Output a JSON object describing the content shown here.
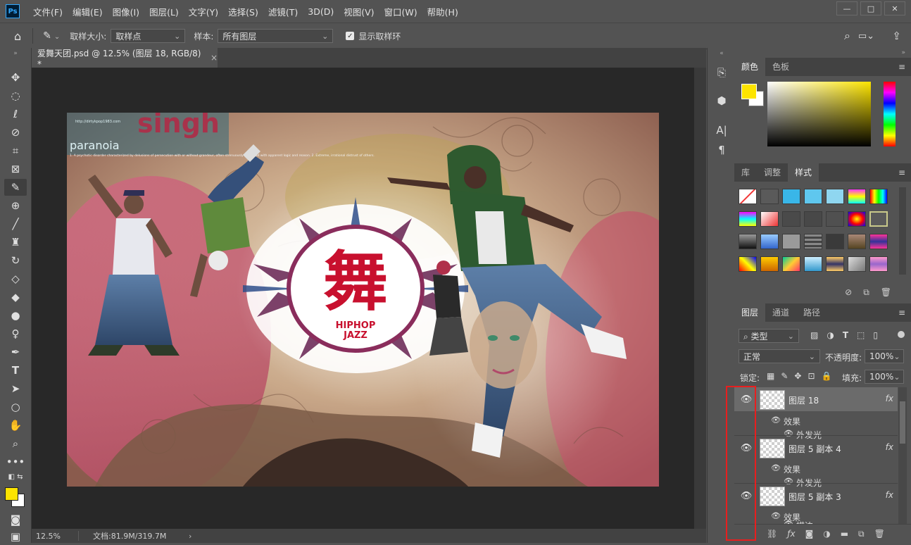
{
  "app": {
    "logo": "Ps"
  },
  "menu": [
    "文件(F)",
    "编辑(E)",
    "图像(I)",
    "图层(L)",
    "文字(Y)",
    "选择(S)",
    "滤镜(T)",
    "3D(D)",
    "视图(V)",
    "窗口(W)",
    "帮助(H)"
  ],
  "window_controls": {
    "minimize": "—",
    "restore": "□",
    "close": "✕"
  },
  "options": {
    "sample_size_label": "取样大小:",
    "sample_size_value": "取样点",
    "sample_label": "样本:",
    "sample_value": "所有图层",
    "show_ring_label": "显示取样环"
  },
  "document": {
    "tab_title": "爱舞天团.psd @ 12.5% (图层 18, RGB/8) *",
    "zoom": "12.5%",
    "doc_info": "文档:81.9M/319.7M"
  },
  "artwork": {
    "headline": "singh",
    "subhead": "paranoia",
    "logo_char": "舞",
    "logo_line1": "HIPHOP",
    "logo_line2": "JAZZ",
    "fine_print": "1. A psychotic disorder characterized by delusions of persecution with or without grandeur, often strenuously defended with apparent logic and reason. 2. Extreme, irrational distrust of others.",
    "url": "http://dirtykpop1983.com"
  },
  "color_panel": {
    "tabs": [
      "颜色",
      "色板"
    ],
    "foreground": "#fde400",
    "background": "#ffffff"
  },
  "styles_panel": {
    "tabs": [
      "库",
      "调整",
      "样式"
    ]
  },
  "layers_panel": {
    "tabs": [
      "图层",
      "通道",
      "路径"
    ],
    "filter_label": "类型",
    "blend_mode": "正常",
    "opacity_label": "不透明度:",
    "opacity_value": "100%",
    "lock_label": "锁定:",
    "fill_label": "填充:",
    "fill_value": "100%",
    "layers": [
      {
        "name": "图层 18",
        "effects_label": "效果",
        "effect": "外发光",
        "fx": "fx"
      },
      {
        "name": "图层 5 副本 4",
        "effects_label": "效果",
        "effect": "外发光",
        "fx": "fx"
      },
      {
        "name": "图层 5 副本 3",
        "effects_label": "效果",
        "effect": "描边",
        "fx": "fx"
      }
    ]
  },
  "highlight_color": "#e81e1e"
}
